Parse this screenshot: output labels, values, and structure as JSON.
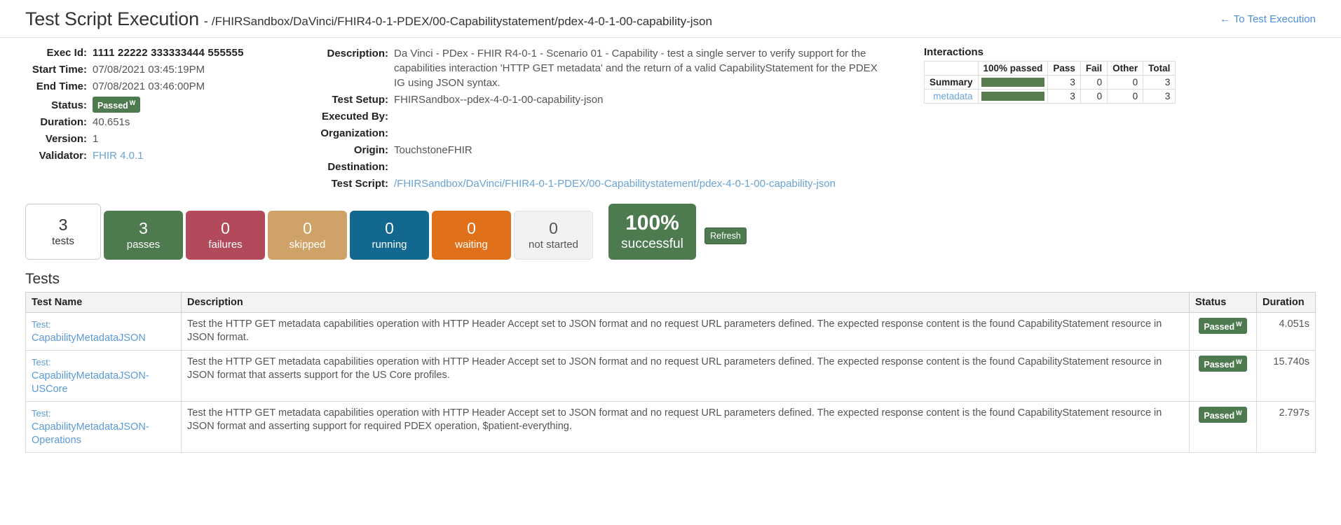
{
  "header": {
    "title": "Test Script Execution",
    "separator": "-",
    "subtitle": "/FHIRSandbox/DaVinci/FHIR4-0-1-PDEX/00-Capabilitystatement/pdex-4-0-1-00-capability-json",
    "back_link": "To Test Execution",
    "back_arrow": "←"
  },
  "details_left": {
    "exec_id_label": "Exec Id:",
    "exec_id": "1111 22222 333333444 555555",
    "start_time_label": "Start Time:",
    "start_time": "07/08/2021 03:45:19PM",
    "end_time_label": "End Time:",
    "end_time": "07/08/2021 03:46:00PM",
    "status_label": "Status:",
    "status": "Passed",
    "status_sup": "W",
    "duration_label": "Duration:",
    "duration": "40.651s",
    "version_label": "Version:",
    "version": "1",
    "validator_label": "Validator:",
    "validator": "FHIR 4.0.1"
  },
  "details_mid": {
    "description_label": "Description:",
    "description": "Da Vinci - PDex - FHIR R4-0-1 - Scenario 01 - Capability - test a single server to verify support for the capabilities interaction 'HTTP GET metadata' and the return of a valid CapabilityStatement for the PDEX IG using JSON syntax.",
    "test_setup_label": "Test Setup:",
    "test_setup": "FHIRSandbox--pdex-4-0-1-00-capability-json",
    "executed_by_label": "Executed By:",
    "executed_by": "",
    "organization_label": "Organization:",
    "organization": "",
    "origin_label": "Origin:",
    "origin": "TouchstoneFHIR",
    "destination_label": "Destination:",
    "destination": "",
    "test_script_label": "Test Script:",
    "test_script": "/FHIRSandbox/DaVinci/FHIR4-0-1-PDEX/00-Capabilitystatement/pdex-4-0-1-00-capability-json"
  },
  "interactions": {
    "title": "Interactions",
    "columns": [
      "",
      "100% passed",
      "Pass",
      "Fail",
      "Other",
      "Total"
    ],
    "rows": [
      {
        "name": "Summary",
        "is_link": false,
        "bar_pct": 100,
        "pass": "3",
        "fail": "0",
        "other": "0",
        "total": "3"
      },
      {
        "name": "metadata",
        "is_link": true,
        "bar_pct": 100,
        "pass": "3",
        "fail": "0",
        "other": "0",
        "total": "3"
      }
    ]
  },
  "stats": [
    {
      "key": "tests",
      "num": "3",
      "label": "tests",
      "color": "#ffffff"
    },
    {
      "key": "passes",
      "num": "3",
      "label": "passes",
      "color": "#4e7a50"
    },
    {
      "key": "failures",
      "num": "0",
      "label": "failures",
      "color": "#b24a5c"
    },
    {
      "key": "skipped",
      "num": "0",
      "label": "skipped",
      "color": "#cfa368"
    },
    {
      "key": "running",
      "num": "0",
      "label": "running",
      "color": "#13688f"
    },
    {
      "key": "waiting",
      "num": "0",
      "label": "waiting",
      "color": "#e1701a"
    },
    {
      "key": "not_started",
      "num": "0",
      "label": "not started",
      "color": "#f2f2f2"
    }
  ],
  "success": {
    "num": "100%",
    "label": "successful",
    "color": "#4e7a50"
  },
  "refresh": {
    "label": "Refresh"
  },
  "tests_section": {
    "heading": "Tests",
    "columns": [
      "Test Name",
      "Description",
      "Status",
      "Duration"
    ],
    "rows": [
      {
        "name_prefix": "Test:",
        "name": "CapabilityMetadataJSON",
        "description": "Test the HTTP GET metadata capabilities operation with HTTP Header Accept set to JSON format and no request URL parameters defined. The expected response content is the found CapabilityStatement resource in JSON format.",
        "status": "Passed",
        "status_sup": "W",
        "duration": "4.051s"
      },
      {
        "name_prefix": "Test:",
        "name": "CapabilityMetadataJSON-USCore",
        "description": "Test the HTTP GET metadata capabilities operation with HTTP Header Accept set to JSON format and no request URL parameters defined. The expected response content is the found CapabilityStatement resource in JSON format that asserts support for the US Core profiles.",
        "status": "Passed",
        "status_sup": "W",
        "duration": "15.740s"
      },
      {
        "name_prefix": "Test:",
        "name": "CapabilityMetadataJSON-Operations",
        "description": "Test the HTTP GET metadata capabilities operation with HTTP Header Accept set to JSON format and no request URL parameters defined. The expected response content is the found CapabilityStatement resource in JSON format and asserting support for required PDEX operation, $patient-everything.",
        "status": "Passed",
        "status_sup": "W",
        "duration": "2.797s"
      }
    ]
  }
}
